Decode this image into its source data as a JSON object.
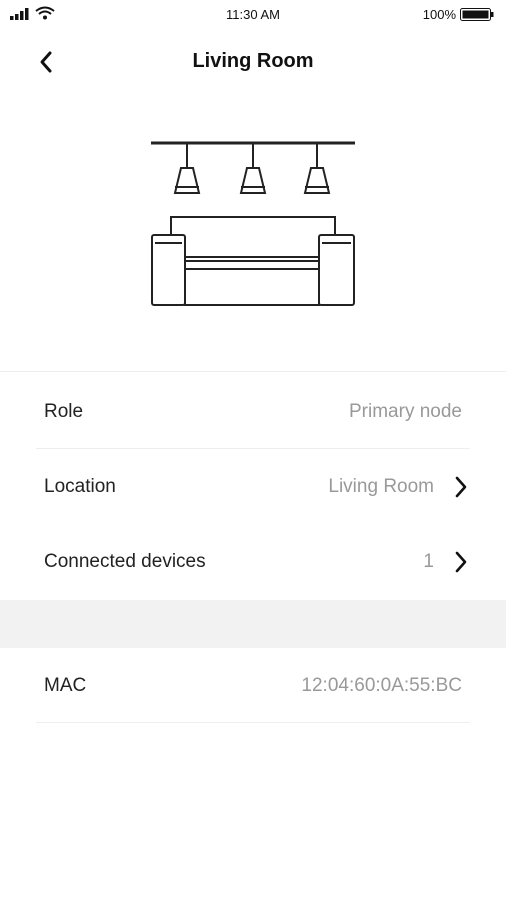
{
  "status_bar": {
    "time": "11:30 AM",
    "battery_percent": "100%",
    "icons": [
      "signal-icon",
      "wifi-icon",
      "battery-icon"
    ]
  },
  "header": {
    "title": "Living Room",
    "back_icon": "chevron-left-icon"
  },
  "illustration": {
    "icon": "living-room-sofa-lamps-illustration"
  },
  "details": [
    {
      "label": "Role",
      "value": "Primary node"
    },
    {
      "label": "Location",
      "value": "Living Room"
    },
    {
      "label": "Connected devices",
      "value": "1"
    }
  ],
  "network": {
    "mac_label": "MAC",
    "mac_value": "12:04:60:0A:55:BC"
  },
  "colors": {
    "primary_text": "#222222",
    "secondary_text": "#999999",
    "separator": "#eeeeee",
    "section_gap": "#f2f2f2"
  }
}
